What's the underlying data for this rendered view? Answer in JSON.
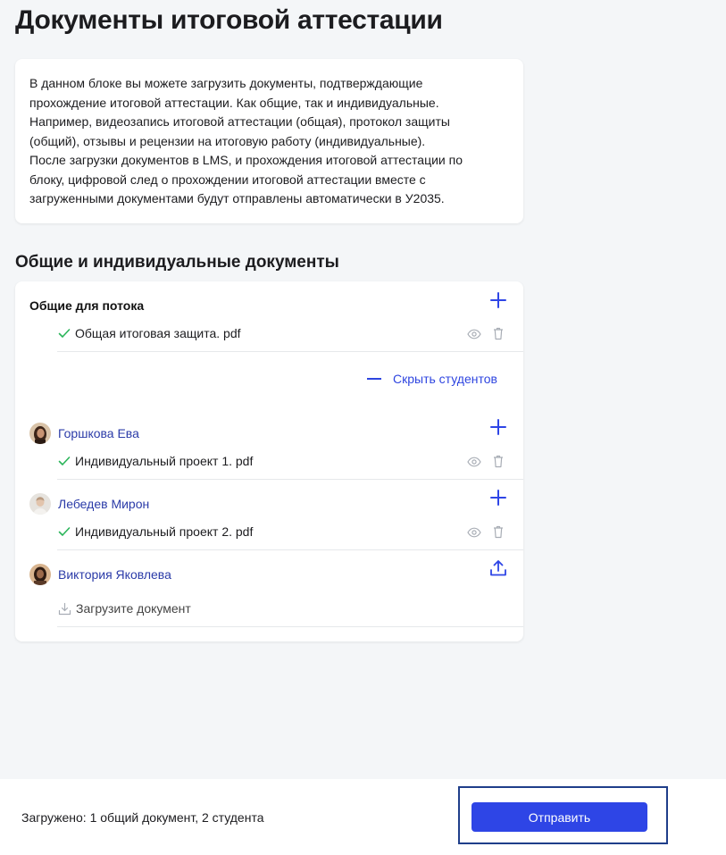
{
  "page": {
    "title": "Документы итоговой аттестации"
  },
  "info": {
    "lines": [
      "В данном блоке вы можете загрузить документы, подтверждающие",
      "прохождение итоговой аттестации. Как общие, так и индивидуальные.",
      "Например, видеозапись итоговой аттестации (общая), протокол защиты",
      "(общий), отзывы и рецензии на итоговую работу (индивидуальные).",
      "После загрузки документов в LMS, и прохождения итоговой аттестации по",
      "блоку, цифровой след о прохождении итоговой аттестации вместе с",
      "загруженными документами будут отправлены автоматически в У2035."
    ]
  },
  "documents": {
    "section_title": "Общие и индивидуальные документы",
    "common": {
      "title": "Общие для потока",
      "files": [
        "Общая итоговая защита. pdf"
      ]
    },
    "hide_students_label": "Скрыть студентов",
    "students": [
      {
        "name": "Горшкова Ева",
        "file": "Индивидуальный проект 1. pdf"
      },
      {
        "name": "Лебедев Мирон",
        "file": "Индивидуальный проект 2. pdf"
      },
      {
        "name": "Виктория Яковлева",
        "upload_label": "Загрузите документ"
      }
    ]
  },
  "footer": {
    "status": "Загружено: 1 общий документ, 2 студента",
    "submit_label": "Отправить"
  },
  "colors": {
    "accent": "#2e45e6",
    "link": "#2b3ba8",
    "success": "#2bb55a"
  }
}
